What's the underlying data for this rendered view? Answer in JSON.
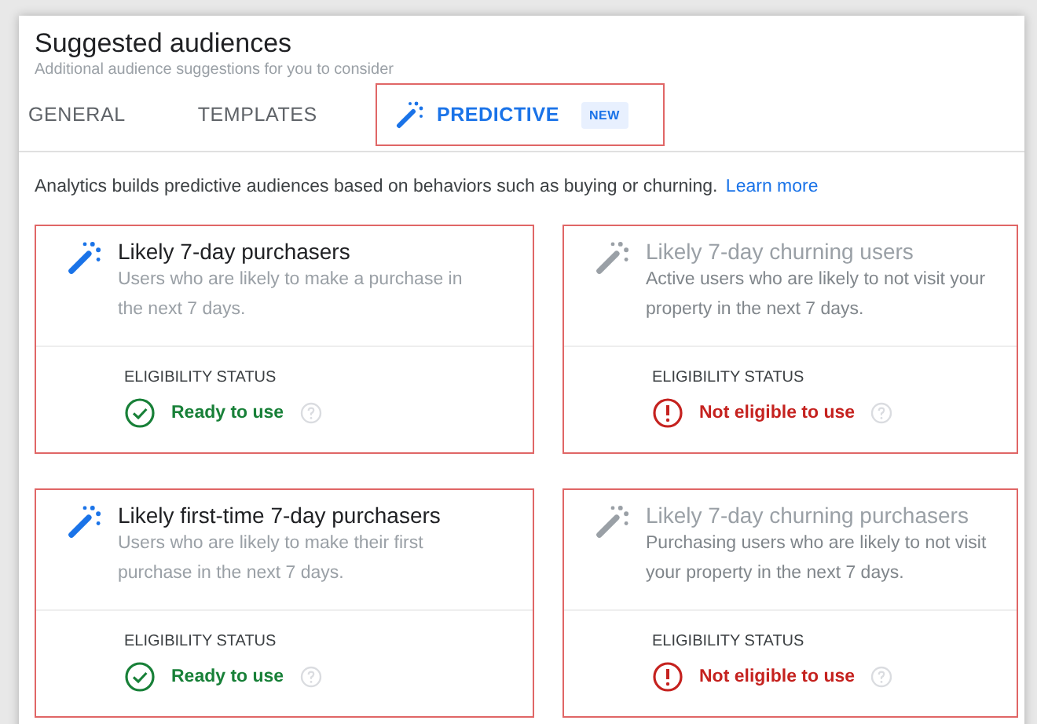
{
  "header": {
    "title": "Suggested audiences",
    "subtitle": "Additional audience suggestions for you to consider"
  },
  "tabs": [
    {
      "label": "GENERAL",
      "selected": false,
      "icon": false
    },
    {
      "label": "TEMPLATES",
      "selected": false,
      "icon": false
    },
    {
      "label": "PREDICTIVE",
      "selected": true,
      "icon": true,
      "badge": "NEW"
    }
  ],
  "intro": {
    "text": "Analytics builds predictive audiences based on behaviors such as buying or churning.",
    "link": "Learn more"
  },
  "cards": [
    {
      "title": "Likely 7-day purchasers",
      "description": "Users who are likely to make a purchase in the next 7 days.",
      "status_label": "ELIGIBILITY STATUS",
      "status": "Ready to use",
      "kind": "ready"
    },
    {
      "title": "Likely 7-day churning users",
      "description": "Active users who are likely to not visit your property in the next 7 days.",
      "status_label": "ELIGIBILITY STATUS",
      "status": "Not eligible to use",
      "kind": "not_eligible"
    },
    {
      "title": "Likely first-time 7-day purchasers",
      "description": "Users who are likely to make their first purchase in the next 7 days.",
      "status_label": "ELIGIBILITY STATUS",
      "status": "Ready to use",
      "kind": "ready"
    },
    {
      "title": "Likely 7-day churning purchasers",
      "description": "Purchasing users who are likely to not visit your property in the next 7 days.",
      "status_label": "ELIGIBILITY STATUS",
      "status": "Not eligible to use",
      "kind": "not_eligible"
    }
  ]
}
